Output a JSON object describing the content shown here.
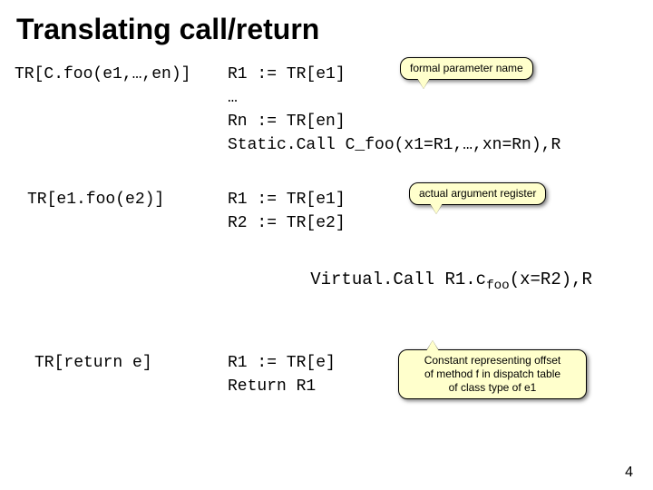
{
  "title": "Translating call/return",
  "row1": {
    "lhs": "TR[C.foo(e1,…,en)]",
    "line1": "R1 := TR[e1]",
    "line2": "…",
    "line3": "Rn := TR[en]",
    "line4": "Static.Call C_foo(x1=R1,…,xn=Rn),R",
    "callout": "formal parameter name"
  },
  "row2": {
    "lhs": "TR[e1.foo(e2)]",
    "line1": "R1 := TR[e1]",
    "line2": "R2 := TR[e2]",
    "line3_pre": "Virtual.Call R1.c",
    "line3_sub": "foo",
    "line3_post": "(x=R2),R",
    "callout": "actual argument register"
  },
  "row3": {
    "lhs": "TR[return e]",
    "line1": "R1 := TR[e]",
    "line2": "Return R1",
    "callout_l1": "Constant representing offset",
    "callout_l2": "of method f in dispatch table",
    "callout_l3": "of class type of e1"
  },
  "pageno": "4"
}
